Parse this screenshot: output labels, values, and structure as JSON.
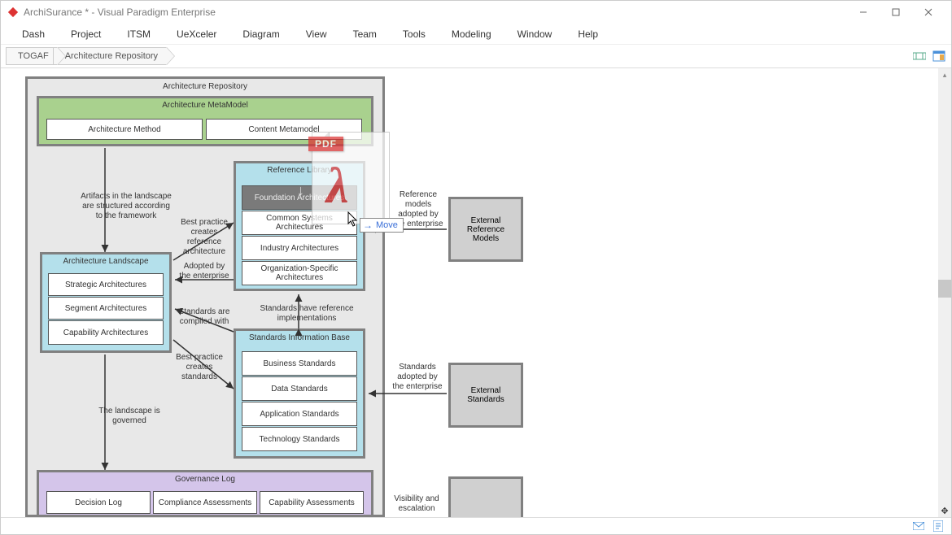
{
  "title": "ArchiSurance * - Visual Paradigm Enterprise",
  "menu": [
    "Dash",
    "Project",
    "ITSM",
    "UeXceler",
    "Diagram",
    "View",
    "Team",
    "Tools",
    "Modeling",
    "Window",
    "Help"
  ],
  "breadcrumb": [
    "TOGAF",
    "Architecture Repository"
  ],
  "drag": {
    "badge": "PDF",
    "tooltip": "Move"
  },
  "repo": {
    "title": "Architecture Repository",
    "meta": {
      "title": "Architecture MetaModel",
      "cells": [
        "Architecture Method",
        "Content Metamodel"
      ]
    },
    "reflib": {
      "title": "Reference Library",
      "cells": [
        "Foundation Architectures",
        "Common Systems Architectures",
        "Industry Architectures",
        "Organization-Specific Architectures"
      ]
    },
    "landscape": {
      "title": "Architecture Landscape",
      "cells": [
        "Strategic Architectures",
        "Segment Architectures",
        "Capability Architectures"
      ]
    },
    "sib": {
      "title": "Standards Information Base",
      "cells": [
        "Business Standards",
        "Data Standards",
        "Application Standards",
        "Technology Standards"
      ]
    },
    "gov": {
      "title": "Governance Log",
      "cells": [
        "Decision Log",
        "Compliance Assessments",
        "Capability Assessments"
      ]
    },
    "ext_ref": "External Reference Models",
    "ext_std": "External Standards"
  },
  "labels": {
    "artifacts": "Artifacts in the landscape are structured according to the framework",
    "bestpractice_ref": "Best practice creates reference architecture",
    "adopted": "Adopted by the enterprise",
    "std_compiled": "Standards are compiled with",
    "bestpractice_std": "Best practice creates standards",
    "std_have_ref": "Standards have reference implementations",
    "ref_models_adopted": "Reference models adopted by the enterprise",
    "std_adopted": "Standards adopted by the enterprise",
    "landscape_gov": "The landscape is governed",
    "visibility": "Visibility and escalation"
  }
}
